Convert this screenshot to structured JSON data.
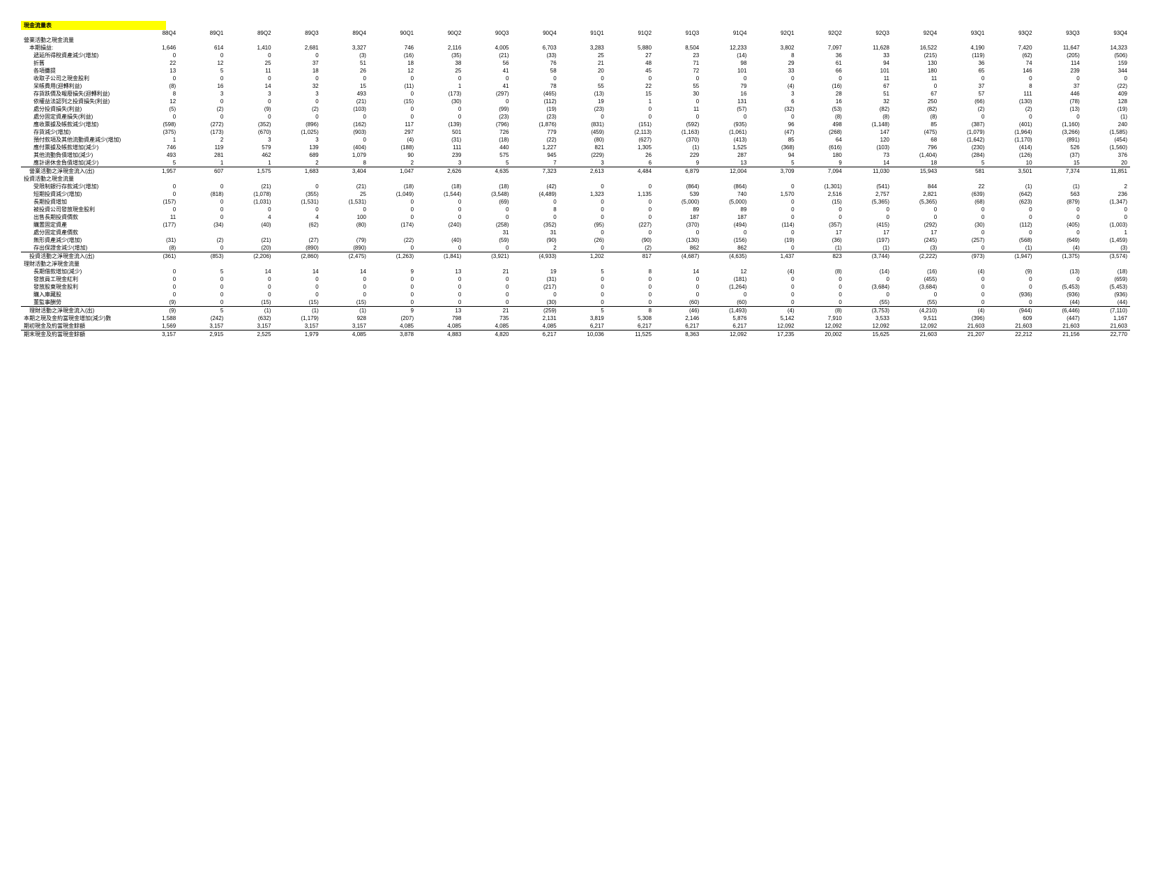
{
  "title": "現金流量表",
  "periods": [
    "88Q4",
    "89Q1",
    "89Q2",
    "89Q3",
    "89Q4",
    "90Q1",
    "90Q2",
    "90Q3",
    "90Q4",
    "91Q1",
    "91Q2",
    "91Q3",
    "91Q4",
    "92Q1",
    "92Q2",
    "92Q3",
    "92Q4",
    "93Q1",
    "93Q2",
    "93Q3",
    "93Q4"
  ],
  "rows": [
    {
      "label": "營業活動之現金流量",
      "cls": "section",
      "vals": null
    },
    {
      "label": "本期損益:",
      "cls": "indent1",
      "vals": [
        1646,
        614,
        1410,
        2681,
        3327,
        746,
        2116,
        4005,
        6703,
        3283,
        5880,
        8504,
        12233,
        3802,
        7097,
        11628,
        16522,
        4190,
        7420,
        11647,
        14323
      ]
    },
    {
      "label": "遞延所得稅資產減少(增加)",
      "cls": "indent2",
      "vals": [
        0,
        0,
        0,
        0,
        -3,
        -16,
        -35,
        -21,
        -33,
        25,
        27,
        23,
        -14,
        8,
        36,
        33,
        -215,
        -119,
        -62,
        -205,
        -506
      ]
    },
    {
      "label": "折舊",
      "cls": "indent2",
      "vals": [
        22,
        12,
        25,
        37,
        51,
        18,
        38,
        56,
        76,
        21,
        48,
        71,
        98,
        29,
        61,
        94,
        130,
        36,
        74,
        114,
        159
      ]
    },
    {
      "label": "各項攤提",
      "cls": "indent2",
      "vals": [
        13,
        5,
        11,
        18,
        26,
        12,
        25,
        41,
        58,
        20,
        45,
        72,
        101,
        33,
        66,
        101,
        180,
        65,
        146,
        239,
        344
      ]
    },
    {
      "label": "收取子公司之現金股利",
      "cls": "indent2",
      "vals": [
        0,
        0,
        0,
        0,
        0,
        0,
        0,
        0,
        0,
        0,
        0,
        0,
        0,
        0,
        0,
        11,
        11,
        0,
        0,
        0,
        0
      ]
    },
    {
      "label": "呆帳費用(迴轉利益)",
      "cls": "indent2",
      "vals": [
        -8,
        16,
        14,
        32,
        15,
        -11,
        1,
        41,
        78,
        55,
        22,
        55,
        79,
        -4,
        -16,
        67,
        0,
        37,
        8,
        37,
        -22
      ]
    },
    {
      "label": "存貨跌價及報廢損失(迴轉利益)",
      "cls": "indent2",
      "vals": [
        8,
        3,
        3,
        3,
        493,
        0,
        -173,
        -297,
        -465,
        -13,
        15,
        30,
        16,
        3,
        28,
        51,
        67,
        57,
        111,
        446,
        409
      ]
    },
    {
      "label": "依權益法認列之投資損失(利益)",
      "cls": "indent2",
      "vals": [
        12,
        0,
        0,
        0,
        -21,
        -15,
        -30,
        0,
        -112,
        19,
        1,
        0,
        131,
        6,
        16,
        32,
        250,
        -66,
        -130,
        -78,
        128
      ]
    },
    {
      "label": "處分投資損失(利益)",
      "cls": "indent2",
      "vals": [
        -5,
        -2,
        -9,
        -2,
        -103,
        0,
        0,
        -99,
        -19,
        -23,
        0,
        11,
        -57,
        -32,
        -53,
        -82,
        -82,
        -2,
        -2,
        -13,
        -19
      ]
    },
    {
      "label": "處分固定資產損失(利益)",
      "cls": "indent2",
      "vals": [
        0,
        0,
        0,
        0,
        0,
        0,
        0,
        -23,
        -23,
        0,
        0,
        0,
        0,
        0,
        -8,
        -8,
        -8,
        0,
        0,
        0,
        -1
      ]
    },
    {
      "label": "應收票據及帳款減少(增加)",
      "cls": "indent2",
      "vals": [
        -598,
        -272,
        -352,
        -896,
        -162,
        117,
        -139,
        -796,
        -1876,
        -831,
        -151,
        -592,
        -935,
        96,
        498,
        -1148,
        85,
        -387,
        -401,
        -1160,
        240
      ]
    },
    {
      "label": "存貨減少(增加)",
      "cls": "indent2",
      "vals": [
        -375,
        -173,
        -670,
        -1025,
        -903,
        297,
        501,
        726,
        779,
        -459,
        -2113,
        -1163,
        -1061,
        -47,
        -268,
        147,
        -475,
        -1079,
        -1964,
        -3266,
        -1585
      ]
    },
    {
      "label": "預付款項及其他流動資產減少(增加)",
      "cls": "indent2",
      "vals": [
        1,
        2,
        3,
        3,
        0,
        -4,
        -31,
        -18,
        -22,
        -80,
        -627,
        -370,
        -413,
        85,
        64,
        120,
        68,
        -1642,
        -1170,
        -891,
        -454
      ]
    },
    {
      "label": "應付票據及帳款增加(減少)",
      "cls": "indent2",
      "vals": [
        746,
        119,
        579,
        139,
        -404,
        -188,
        111,
        440,
        1227,
        821,
        1305,
        -1,
        1525,
        -368,
        -616,
        -103,
        796,
        -230,
        -414,
        526,
        -1560
      ]
    },
    {
      "label": "其他流動負債增加(減少)",
      "cls": "indent2",
      "vals": [
        493,
        281,
        462,
        689,
        1079,
        90,
        239,
        575,
        945,
        -229,
        26,
        229,
        287,
        94,
        180,
        73,
        -1404,
        -284,
        -126,
        -37,
        376
      ]
    },
    {
      "label": "應計退休金負債增加(減少)",
      "cls": "indent2",
      "vals": [
        5,
        1,
        1,
        2,
        8,
        2,
        3,
        5,
        7,
        3,
        6,
        9,
        13,
        5,
        9,
        14,
        18,
        5,
        10,
        15,
        20
      ]
    },
    {
      "label": "營業活動之淨現金流入(出)",
      "cls": "indent1 total-row",
      "vals": [
        1957,
        607,
        1575,
        1683,
        3404,
        1047,
        2626,
        4635,
        7323,
        2613,
        4484,
        6879,
        12004,
        3709,
        7094,
        11030,
        15943,
        581,
        3501,
        7374,
        11851
      ]
    },
    {
      "label": "投資活動之現金流量",
      "cls": "section",
      "vals": null
    },
    {
      "label": "受限制銀行存款減少(增加)",
      "cls": "indent2",
      "vals": [
        0,
        0,
        -21,
        0,
        -21,
        -18,
        -18,
        -18,
        -42,
        0,
        0,
        -864,
        -864,
        0,
        -1301,
        -541,
        844,
        22,
        -1,
        -1,
        2
      ]
    },
    {
      "label": "短期投資減少(增加)",
      "cls": "indent2",
      "vals": [
        0,
        -818,
        -1078,
        -355,
        25,
        -1049,
        -1544,
        -3548,
        -4489,
        1323,
        1135,
        539,
        740,
        1570,
        2516,
        2757,
        2821,
        -639,
        -642,
        563,
        236
      ]
    },
    {
      "label": "長期投資增加",
      "cls": "indent2",
      "vals": [
        -157,
        0,
        -1031,
        -1531,
        -1531,
        0,
        0,
        -69,
        0,
        0,
        0,
        -5000,
        -5000,
        0,
        -15,
        -5365,
        -5365,
        -68,
        -623,
        -879,
        -1347
      ]
    },
    {
      "label": "被投資公司發放現金股利",
      "cls": "indent2",
      "vals": [
        0,
        0,
        0,
        0,
        0,
        0,
        0,
        0,
        8,
        0,
        0,
        89,
        89,
        0,
        0,
        0,
        0,
        0,
        0,
        0,
        0
      ]
    },
    {
      "label": "出售長期投資價款",
      "cls": "indent2",
      "vals": [
        11,
        0,
        4,
        4,
        100,
        0,
        0,
        0,
        0,
        0,
        0,
        187,
        187,
        0,
        0,
        0,
        0,
        0,
        0,
        0,
        0
      ]
    },
    {
      "label": "購置固定資產",
      "cls": "indent2",
      "vals": [
        -177,
        -34,
        -40,
        -62,
        -80,
        -174,
        -240,
        -258,
        -352,
        -95,
        -227,
        -370,
        -494,
        -114,
        -357,
        -415,
        -292,
        -30,
        -112,
        -405,
        -1003
      ]
    },
    {
      "label": "處分固定資產價款",
      "cls": "indent2",
      "vals": [
        null,
        null,
        null,
        null,
        null,
        null,
        null,
        31,
        31,
        0,
        0,
        0,
        0,
        0,
        17,
        17,
        17,
        0,
        0,
        0,
        1
      ]
    },
    {
      "label": "無形資產減少(增加)",
      "cls": "indent2",
      "vals": [
        -31,
        -2,
        -21,
        -27,
        -79,
        -22,
        -40,
        -59,
        -90,
        -26,
        -90,
        -130,
        -156,
        -19,
        -36,
        -197,
        -245,
        -257,
        -568,
        -649,
        -1459
      ]
    },
    {
      "label": "存出保證金減少(增加)",
      "cls": "indent2",
      "vals": [
        -8,
        0,
        -20,
        -890,
        -890,
        0,
        0,
        0,
        2,
        0,
        -2,
        862,
        862,
        0,
        -1,
        -1,
        -3,
        0,
        -1,
        -4,
        -3
      ]
    },
    {
      "label": "投資活動之淨現金流入(出)",
      "cls": "indent1 total-row",
      "vals": [
        -361,
        -853,
        -2206,
        -2860,
        -2475,
        -1263,
        -1841,
        -3921,
        -4933,
        1202,
        817,
        -4687,
        -4635,
        1437,
        823,
        -3744,
        -2222,
        -973,
        -1947,
        -1375,
        -3574
      ]
    },
    {
      "label": "理財活動之淨現金流量",
      "cls": "section",
      "vals": null
    },
    {
      "label": "長期借款增加(減少)",
      "cls": "indent2",
      "vals": [
        0,
        5,
        14,
        14,
        14,
        9,
        13,
        21,
        19,
        5,
        8,
        14,
        12,
        -4,
        -8,
        -14,
        -16,
        -4,
        -9,
        -13,
        -18
      ]
    },
    {
      "label": "發放員工現金紅利",
      "cls": "indent2",
      "vals": [
        0,
        0,
        0,
        0,
        0,
        0,
        0,
        0,
        -31,
        0,
        0,
        0,
        -181,
        0,
        0,
        0,
        -455,
        0,
        0,
        0,
        -659
      ]
    },
    {
      "label": "發放股東現金股利",
      "cls": "indent2",
      "vals": [
        0,
        0,
        0,
        0,
        0,
        0,
        0,
        0,
        -217,
        0,
        0,
        0,
        -1264,
        0,
        0,
        -3684,
        -3684,
        0,
        0,
        -5453,
        -5453
      ]
    },
    {
      "label": "購入庫藏股",
      "cls": "indent2",
      "vals": [
        0,
        0,
        0,
        0,
        0,
        0,
        0,
        0,
        0,
        0,
        0,
        0,
        0,
        0,
        0,
        0,
        0,
        0,
        -936,
        -936,
        -936
      ]
    },
    {
      "label": "董監事酬勞",
      "cls": "indent2",
      "vals": [
        -9,
        0,
        -15,
        -15,
        -15,
        0,
        0,
        0,
        -30,
        0,
        0,
        -60,
        -60,
        0,
        0,
        -55,
        -55,
        0,
        0,
        -44,
        -44
      ]
    },
    {
      "label": "理財活動之淨現金流入(出)",
      "cls": "indent1 total-row",
      "vals": [
        -9,
        5,
        -1,
        -1,
        -1,
        9,
        13,
        21,
        -259,
        5,
        8,
        -46,
        -1493,
        -4,
        -8,
        -3753,
        -4210,
        -4,
        -944,
        -6446,
        -7110
      ]
    },
    {
      "label": "本期之現及金約當現金增加(減少)數",
      "cls": "",
      "vals": [
        1588,
        -242,
        -632,
        -1179,
        928,
        -207,
        798,
        735,
        2131,
        3819,
        5308,
        2146,
        5876,
        5142,
        7910,
        3533,
        9511,
        -396,
        609,
        -447,
        1167
      ]
    },
    {
      "label": "期初現金及約當現金餘額",
      "cls": "",
      "vals": [
        1569,
        3157,
        3157,
        3157,
        3157,
        4085,
        4085,
        4085,
        4085,
        6217,
        6217,
        6217,
        6217,
        12092,
        12092,
        12092,
        12092,
        21603,
        21603,
        21603,
        21603
      ]
    },
    {
      "label": "期末現金及約當現金餘額",
      "cls": "total-row",
      "vals": [
        3157,
        2915,
        2525,
        1979,
        4085,
        3878,
        4883,
        4820,
        6217,
        10036,
        11525,
        8363,
        12092,
        17235,
        20002,
        15625,
        21603,
        21207,
        22212,
        21156,
        22770
      ]
    }
  ]
}
